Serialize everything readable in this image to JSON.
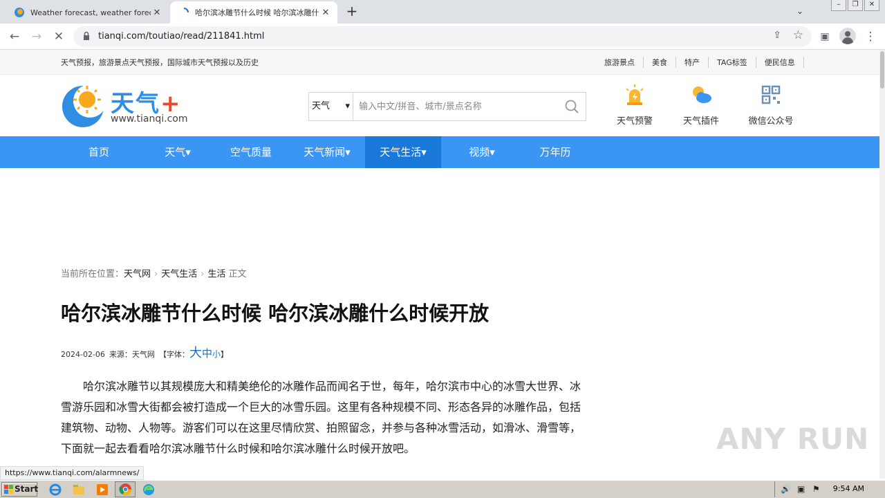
{
  "browser": {
    "tabs": [
      {
        "title": "Weather forecast, weather forecast",
        "active": false
      },
      {
        "title": "哈尔滨冰雕节什么时候 哈尔滨冰雕什",
        "active": true
      }
    ],
    "url": "tianqi.com/toutiao/read/211841.html"
  },
  "site": {
    "top_marquee": "天气预报，旅游景点天气预报，国际城市天气预报以及历史",
    "top_links": [
      "旅游景点",
      "美食",
      "特产",
      "TAG标签",
      "便民信息"
    ],
    "logo_text": "天气",
    "logo_plus": "+",
    "logo_domain": "www.tianqi.com",
    "search": {
      "select_value": "天气",
      "placeholder": "输入中文/拼音、城市/景点名称"
    },
    "quick_links": [
      {
        "label": "天气预警",
        "icon": "warning-light-icon"
      },
      {
        "label": "天气插件",
        "icon": "sun-cloud-icon"
      },
      {
        "label": "微信公众号",
        "icon": "qr-code-icon"
      }
    ],
    "nav": [
      {
        "label": "首页",
        "dropdown": false,
        "active": false
      },
      {
        "label": "天气▾",
        "dropdown": true,
        "active": false
      },
      {
        "label": "空气质量",
        "dropdown": false,
        "active": false
      },
      {
        "label": "天气新闻▾",
        "dropdown": true,
        "active": false
      },
      {
        "label": "天气生活▾",
        "dropdown": true,
        "active": true
      },
      {
        "label": "视频▾",
        "dropdown": true,
        "active": false
      },
      {
        "label": "万年历",
        "dropdown": false,
        "active": false
      }
    ]
  },
  "breadcrumb": {
    "prefix": "当前所在位置：",
    "items": [
      "天气网",
      "天气生活",
      "生活"
    ],
    "suffix": "正文"
  },
  "article": {
    "title": "哈尔滨冰雕节什么时候 哈尔滨冰雕什么时候开放",
    "date": "2024-02-06",
    "source": "来源：天气网",
    "font_label_open": "【字体：",
    "font_sizes": [
      "大",
      "中",
      "小"
    ],
    "font_label_close": "】",
    "body": "哈尔滨冰雕节以其规模庞大和精美绝伦的冰雕作品而闻名于世，每年，哈尔滨市中心的冰雪大世界、冰雪游乐园和冰雪大街都会被打造成一个巨大的冰雪乐园。这里有各种规模不同、形态各异的冰雕作品，包括建筑物、动物、人物等。游客们可以在这里尽情欣赏、拍照留念，并参与各种冰雪活动，如滑冰、滑雪等，下面就一起去看看哈尔滨冰雕节什么时候和哈尔滨冰雕什么时候开放吧。"
  },
  "status_url": "https://www.tianqi.com/alarmnews/",
  "watermark": "ANY RUN",
  "taskbar": {
    "start_label": "Start",
    "clock": "9:54 AM"
  },
  "colors": {
    "nav_bg": "#3b95f3",
    "nav_active": "#1a78d9",
    "logo_blue": "#2f8de4",
    "logo_red": "#e8492a"
  }
}
